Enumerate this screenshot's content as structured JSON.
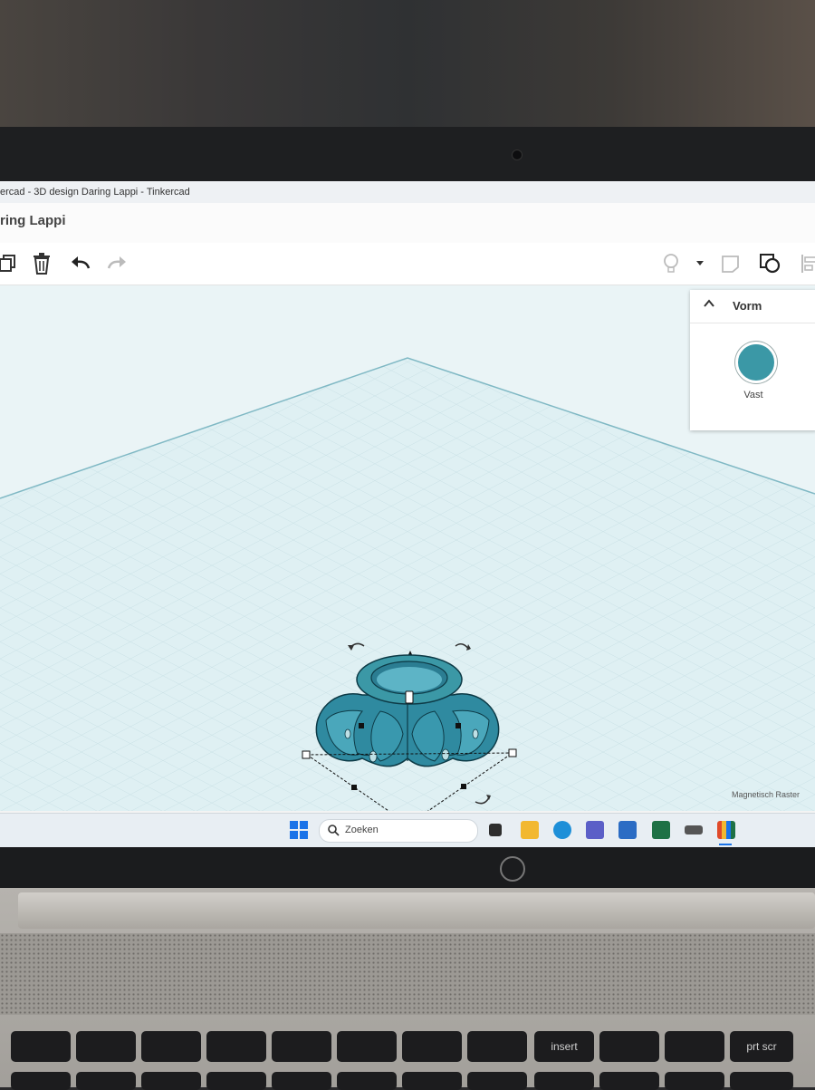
{
  "window": {
    "title": "ercad - 3D design Daring Lappi - Tinkercad",
    "design_name": "ring Lappi"
  },
  "toolbar": {
    "tools": [
      {
        "name": "copy-icon"
      },
      {
        "name": "trash-icon"
      },
      {
        "name": "undo-icon"
      },
      {
        "name": "redo-icon"
      }
    ],
    "right_tools": [
      {
        "name": "lightbulb-icon"
      },
      {
        "name": "dropdown-arrow-icon"
      },
      {
        "name": "note-icon"
      },
      {
        "name": "shape-view-icon"
      },
      {
        "name": "align-icon"
      }
    ]
  },
  "shape_panel": {
    "title": "Vorm",
    "fill_label": "Vast",
    "fill_color": "#3b98a6"
  },
  "viewport": {
    "snap_grid_label": "Magnetisch Raster",
    "object_color": "#3b98a6"
  },
  "taskbar": {
    "search_placeholder": "Zoeken",
    "apps": [
      {
        "name": "windows-start-icon",
        "color": "#1a73e8"
      },
      {
        "name": "task-view-icon",
        "color": "#333333"
      },
      {
        "name": "file-explorer-icon",
        "color": "#f2b830"
      },
      {
        "name": "edge-icon",
        "color": "#1d8fd8"
      },
      {
        "name": "teams-icon",
        "color": "#5b5fc7"
      },
      {
        "name": "store-icon",
        "color": "#2b6cc4"
      },
      {
        "name": "excel-icon",
        "color": "#1e7145"
      },
      {
        "name": "device-icon",
        "color": "#555555"
      },
      {
        "name": "tinkercad-icon",
        "color": "#e04a2a"
      }
    ]
  },
  "keyboard": {
    "keys": [
      "",
      "",
      "",
      "",
      "",
      "",
      "",
      "",
      "insert",
      "",
      "",
      "prt scr"
    ]
  }
}
